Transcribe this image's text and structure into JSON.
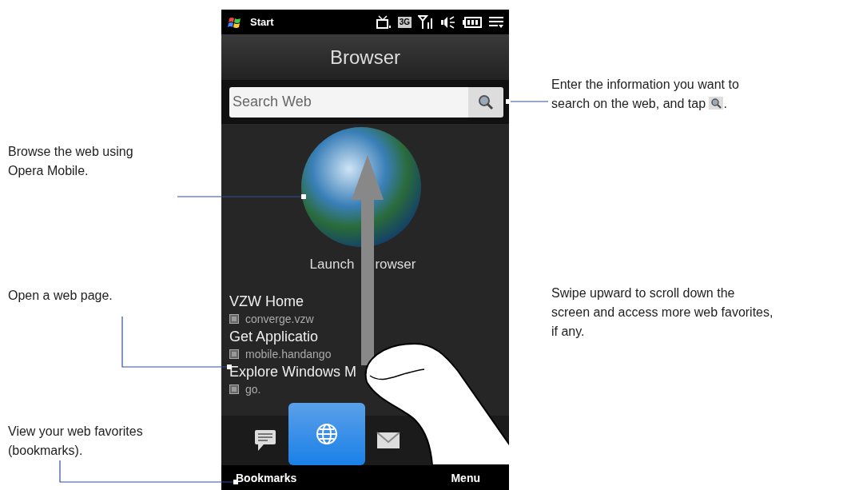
{
  "status_bar": {
    "start_label": "Start",
    "network_label": "3G"
  },
  "title": "Browser",
  "search": {
    "placeholder": "Search Web"
  },
  "launch": {
    "label_parts": [
      "Launch",
      "rowser"
    ]
  },
  "favorites": [
    {
      "title": "VZW Home",
      "url": "converge.vzw"
    },
    {
      "title": "Get Applicatio",
      "url": "mobile.handango"
    },
    {
      "title": "Explore Windows M",
      "url": "go."
    }
  ],
  "dock": [
    {
      "kind": "messages",
      "selected": false
    },
    {
      "kind": "browser",
      "selected": true
    },
    {
      "kind": "mail",
      "selected": false
    }
  ],
  "softkeys": {
    "left": "Bookmarks",
    "right": "Menu"
  },
  "callouts": [
    {
      "lines": [
        "Enter the information you want to",
        "search on the web, and tap"
      ],
      "suffix": "."
    },
    {
      "lines": [
        "Browse the web using",
        "Opera Mobile."
      ]
    },
    {
      "lines": [
        "Open a web page."
      ]
    },
    {
      "lines": [
        "Swipe upward to scroll down the",
        "screen and access more web favorites,",
        "if any."
      ]
    },
    {
      "lines": [
        "View your web favorites",
        "(bookmarks)."
      ]
    }
  ]
}
